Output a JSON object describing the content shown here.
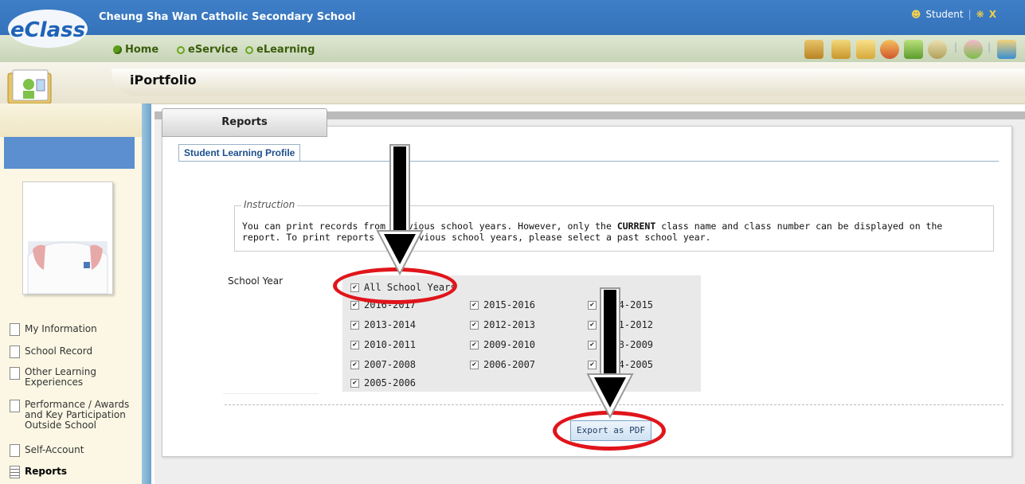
{
  "header": {
    "logo_text": "eClass",
    "school_name": "Cheung Sha Wan Catholic Secondary School",
    "user_label": "Student",
    "nav": [
      "Home",
      "eService",
      "eLearning"
    ]
  },
  "module": {
    "title": "iPortfolio"
  },
  "sidebar": {
    "items": [
      {
        "label": "My Information"
      },
      {
        "label": "School Record"
      },
      {
        "label": "Other Learning Experiences"
      },
      {
        "label": "Performance / Awards and Key Participation Outside School"
      },
      {
        "label": "Self-Account"
      },
      {
        "label": "Reports"
      }
    ]
  },
  "main": {
    "tab": "Reports",
    "subtab": "Student Learning Profile",
    "instruction": {
      "legend": "Instruction",
      "text_before": "You can print records from previous school years. However, only the ",
      "text_strong": "CURRENT",
      "text_after": " class name and class number can be displayed on the report. To print reports for previous school years, please select a past school year."
    },
    "school_year_label": "School Year",
    "all_years_label": "All School Years",
    "years": [
      "2016-2017",
      "2015-2016",
      "2014-2015",
      "2013-2014",
      "2012-2013",
      "2011-2012",
      "2010-2011",
      "2009-2010",
      "2008-2009",
      "2007-2008",
      "2006-2007",
      "2004-2005",
      "2005-2006"
    ],
    "export_label": "Export as PDF"
  },
  "colors": {
    "header_blue": "#2c68b0",
    "annotation_red": "#e0151b",
    "link_green": "#3a5d0d"
  }
}
